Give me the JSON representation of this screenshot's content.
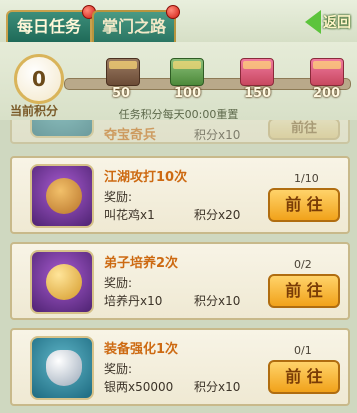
{
  "tabs": {
    "active": "每日任务",
    "inactive": "掌门之路"
  },
  "back": {
    "label": "返回"
  },
  "progress": {
    "score": "0",
    "score_label": "当前积分",
    "milestones": [
      "50",
      "100",
      "150",
      "200"
    ],
    "notice": "任务积分每天00:00重置"
  },
  "tasks": [
    {
      "title": "夺宝奇兵",
      "reward_item": "",
      "points": "积分x10",
      "progress": "",
      "button": "前往"
    },
    {
      "title": "江湖攻打10次",
      "reward_label": "奖励:",
      "reward_item": "叫花鸡x1",
      "points": "积分x20",
      "progress": "1/10",
      "button": "前 往"
    },
    {
      "title": "弟子培养2次",
      "reward_label": "奖励:",
      "reward_item": "培养丹x10",
      "points": "积分x10",
      "progress": "0/2",
      "button": "前 往"
    },
    {
      "title": "装备强化1次",
      "reward_label": "奖励:",
      "reward_item": "银两x50000",
      "points": "积分x10",
      "progress": "0/1",
      "button": "前 往"
    }
  ]
}
